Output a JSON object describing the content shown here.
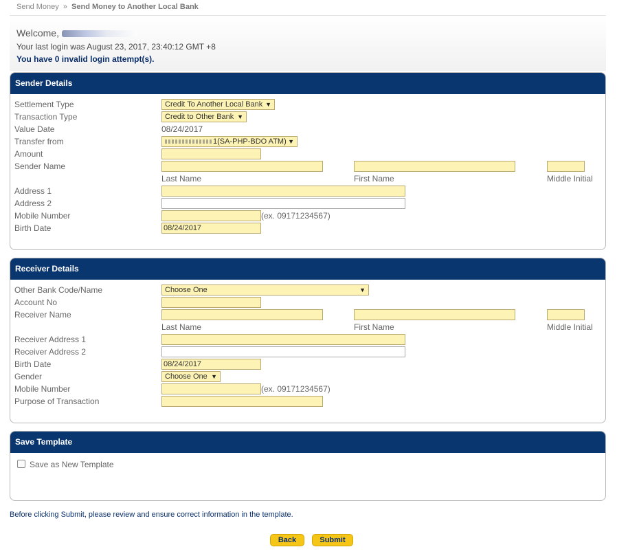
{
  "breadcrumb": {
    "parent": "Send Money",
    "separator": "»",
    "current": "Send Money to Another Local Bank"
  },
  "welcome": {
    "greeting": "Welcome,",
    "last_login": "Your last login was August 23, 2017, 23:40:12 GMT +8",
    "invalid_attempts": "You have 0 invalid login attempt(s)."
  },
  "sender": {
    "title": "Sender Details",
    "settlement_type_label": "Settlement Type",
    "settlement_type_value": "Credit To Another Local Bank",
    "transaction_type_label": "Transaction Type",
    "transaction_type_value": "Credit to Other Bank",
    "value_date_label": "Value Date",
    "value_date_value": "08/24/2017",
    "transfer_from_label": "Transfer from",
    "transfer_from_value": "1(SA-PHP-BDO ATM)",
    "amount_label": "Amount",
    "name_label": "Sender Name",
    "last_name": "Last Name",
    "first_name": "First Name",
    "middle_initial": "Middle Initial",
    "address1_label": "Address 1",
    "address2_label": "Address 2",
    "mobile_label": "Mobile Number",
    "mobile_hint": "(ex. 09171234567)",
    "birth_label": "Birth Date",
    "birth_value": "08/24/2017"
  },
  "receiver": {
    "title": "Receiver Details",
    "bank_label": "Other Bank Code/Name",
    "bank_value": "Choose One",
    "account_label": "Account No",
    "name_label": "Receiver Name",
    "last_name": "Last Name",
    "first_name": "First Name",
    "middle_initial": "Middle Initial",
    "address1_label": "Receiver Address 1",
    "address2_label": "Receiver Address 2",
    "birth_label": "Birth Date",
    "birth_value": "08/24/2017",
    "gender_label": "Gender",
    "gender_value": "Choose One",
    "mobile_label": "Mobile Number",
    "mobile_hint": "(ex. 09171234567)",
    "purpose_label": "Purpose of Transaction"
  },
  "template": {
    "title": "Save Template",
    "save_label": "Save as New Template"
  },
  "note": "Before clicking Submit, please review and ensure correct information in the template.",
  "buttons": {
    "back": "Back",
    "submit": "Submit"
  },
  "colors": {
    "header": "#0a3670",
    "field": "#fdf3b4",
    "button": "#f5c518"
  }
}
